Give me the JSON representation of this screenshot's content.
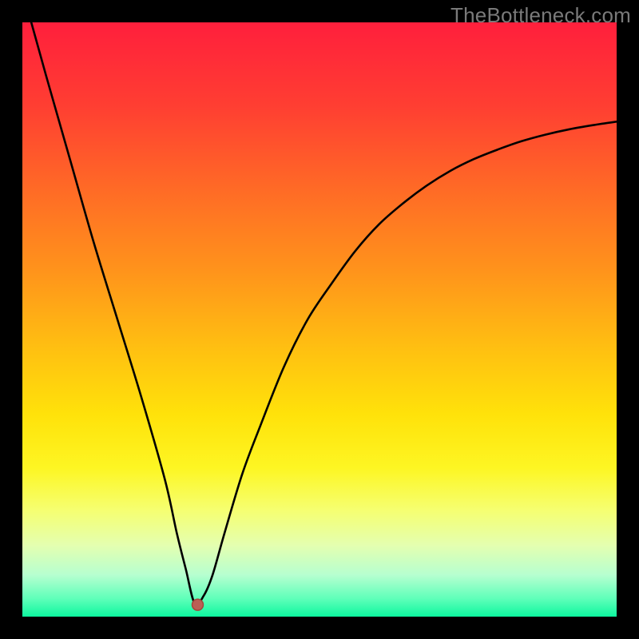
{
  "watermark": "TheBottleneck.com",
  "colors": {
    "frame": "#000000",
    "watermark": "#7a7a7a",
    "curve": "#000000",
    "dot_fill": "#bb5f55",
    "dot_stroke": "#a3463c",
    "gradient_stops": [
      {
        "offset": 0.0,
        "color": "#ff1f3c"
      },
      {
        "offset": 0.14,
        "color": "#ff3e32"
      },
      {
        "offset": 0.28,
        "color": "#ff6a26"
      },
      {
        "offset": 0.42,
        "color": "#ff941b"
      },
      {
        "offset": 0.55,
        "color": "#ffc011"
      },
      {
        "offset": 0.66,
        "color": "#ffe20a"
      },
      {
        "offset": 0.75,
        "color": "#fdf623"
      },
      {
        "offset": 0.82,
        "color": "#f6ff70"
      },
      {
        "offset": 0.88,
        "color": "#e4ffb0"
      },
      {
        "offset": 0.93,
        "color": "#b6ffd0"
      },
      {
        "offset": 0.97,
        "color": "#5effb9"
      },
      {
        "offset": 1.0,
        "color": "#0df79f"
      }
    ]
  },
  "chart_data": {
    "type": "line",
    "title": "",
    "xlabel": "",
    "ylabel": "",
    "xlim": [
      0,
      100
    ],
    "ylim": [
      0,
      100
    ],
    "dot": {
      "x": 29.5,
      "y": 2.0
    },
    "series": [
      {
        "name": "curve",
        "x": [
          1.5,
          4,
          8,
          12,
          16,
          20,
          24,
          26,
          27.5,
          29,
          30.5,
          32,
          34,
          37,
          40,
          44,
          48,
          52,
          56,
          60,
          64,
          68,
          72,
          76,
          80,
          84,
          88,
          92,
          96,
          100
        ],
        "y": [
          100,
          91,
          77,
          63,
          50,
          37,
          23,
          14,
          8,
          2.2,
          3.5,
          7,
          14,
          24,
          32,
          42,
          50,
          56,
          61.5,
          66,
          69.5,
          72.5,
          75,
          77,
          78.6,
          80,
          81.1,
          82,
          82.7,
          83.3
        ]
      }
    ]
  }
}
